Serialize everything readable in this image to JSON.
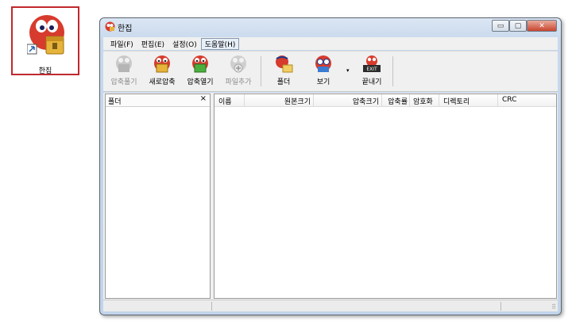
{
  "desktop": {
    "shortcut_label": "한집"
  },
  "window": {
    "title": "한집",
    "minimize_glyph": "▭",
    "maximize_glyph": "▢",
    "close_glyph": "✕"
  },
  "menu": [
    "파일(F)",
    "편집(E)",
    "설정(O)",
    "도움말(H)"
  ],
  "toolbar": {
    "extract": "압축풀기",
    "new_archive": "새로압축",
    "open_archive": "압축열기",
    "add_files": "파일추가",
    "folder": "폴더",
    "view": "보기",
    "view_dropdown": "▾",
    "exit": "끝내기",
    "exit_sign": "EXIT"
  },
  "folder_pane": {
    "title": "폴더",
    "close": "×"
  },
  "file_list": {
    "columns": [
      "이름",
      "원본크기",
      "압축크기",
      "압축률",
      "암호화",
      "디렉토리",
      "CRC"
    ]
  },
  "statusbar": {
    "grip": "⠿"
  }
}
